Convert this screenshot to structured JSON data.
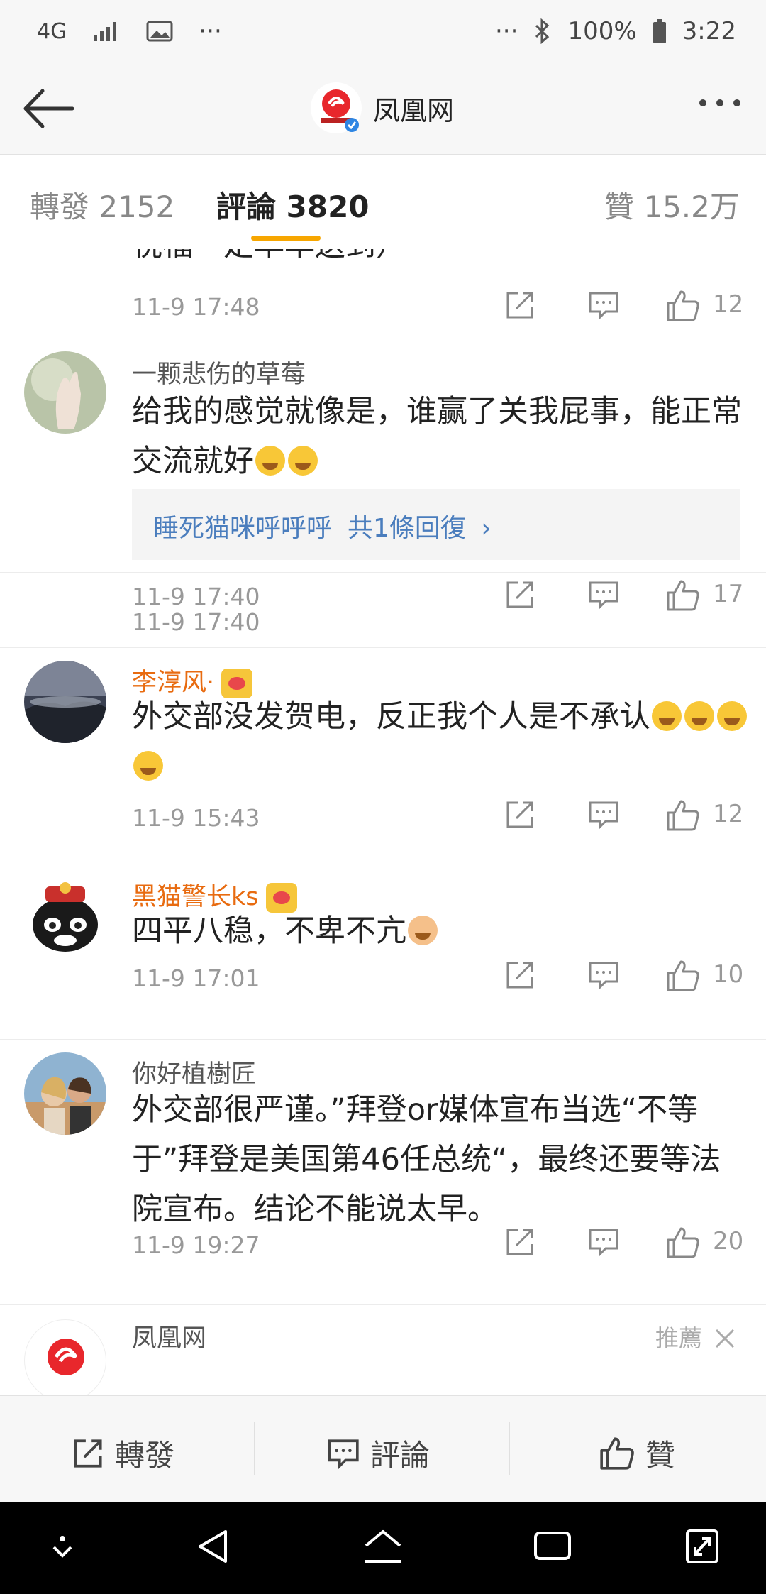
{
  "status_bar": {
    "network": "4G",
    "more": "···",
    "more_right": "···",
    "battery": "100%",
    "time": "3:22"
  },
  "nav": {
    "title": "凤凰网"
  },
  "tabs": {
    "repost": "轉發 2152",
    "comments": "評論 3820",
    "likes": "贊 15.2万"
  },
  "comments": [
    {
      "partial_text": "祝福一定早早送到）",
      "time": "11-9 17:48",
      "likes": "12"
    },
    {
      "name": "一颗悲伤的草莓",
      "text": "给我的感觉就像是，谁赢了关我屁事，能正常交流就好",
      "reply_user": "睡死猫咪呼呼呼",
      "reply_count": "共1條回復",
      "reply_arrow": "›",
      "time": "11-9 17:40",
      "likes": "17"
    },
    {
      "name": "李淳风·",
      "text": "外交部没发贺电，反正我个人是不承认",
      "time": "11-9 15:43",
      "likes": "12"
    },
    {
      "name": "黑猫警长ks",
      "text": "四平八稳，不卑不亢",
      "time": "11-9 17:01",
      "likes": "10"
    },
    {
      "name": "你好植樹匠",
      "text": "外交部很严谨。”拜登or媒体宣布当选“不等于”拜登是美国第46任总统“，最终还要等法院宣布。结论不能说太早。",
      "time": "11-9 19:27",
      "likes": "20"
    },
    {
      "name": "凤凰网",
      "recommend": "推薦"
    }
  ],
  "bottom_bar": {
    "repost": "轉發",
    "comment": "評論",
    "like": "贊"
  },
  "colors": {
    "accent": "#f7a600",
    "vip_name": "#e86b10",
    "link": "#4a7dbd"
  }
}
